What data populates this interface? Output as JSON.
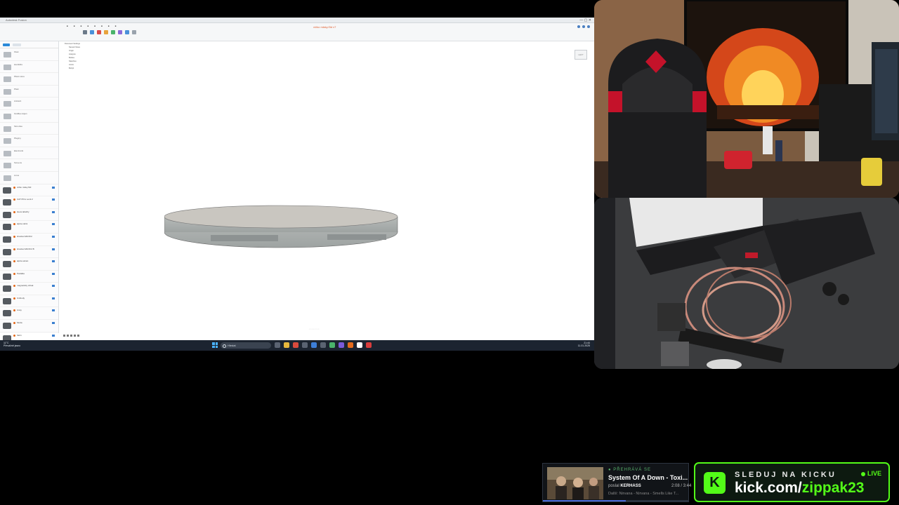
{
  "fusion": {
    "window_title": "Autodesk Fusion",
    "document_title": "víčko misky.f3d v7",
    "viewcube_label": "LEFT",
    "folders": [
      "Fitek",
      "Hardsfire",
      "Pliant store",
      "Pitek",
      "Antracit",
      "Grafika stojan",
      "Simonka",
      "Pluginy",
      "Electronik",
      "Screens",
      "Linos"
    ],
    "files": [
      {
        "name": "víčko misky.f3d"
      },
      {
        "name": "CAT PICs Lock 2"
      },
      {
        "name": "sleva tabelhy"
      },
      {
        "name": "alpina dolni"
      },
      {
        "name": "Hracka NAK3V2"
      },
      {
        "name": "Hracka NAK3V2 B"
      },
      {
        "name": "alpina ekran"
      },
      {
        "name": "Pedalka"
      },
      {
        "name": "magneticky drzak"
      },
      {
        "name": "Unibody"
      },
      {
        "name": "Lissy"
      },
      {
        "name": "Moda"
      },
      {
        "name": "Skrin"
      }
    ],
    "browser_tree": [
      "Document Settings",
      "Named Views",
      "Origin",
      "Analysis",
      "Bodies",
      "Sketches",
      "Joints",
      "Body1"
    ],
    "taskbar": {
      "weather_temp": "11°C",
      "weather_desc": "Převážně jasno",
      "search_placeholder": "Hledat",
      "time": "21:44",
      "date": "11.01.2025"
    }
  },
  "now_playing": {
    "label": "● PŘEHRÁVÁ SE",
    "song": "System Of A Down - Toxi...",
    "requested_by_prefix": "poslal",
    "requested_by": "KERHASS",
    "time": "2:08 / 3:44",
    "next": "Další: Nirvana - Nirvana - Smells Like T...",
    "progress": 0.57
  },
  "kick": {
    "logo_letter": "K",
    "cta": "SLEDUJ NA KICKU",
    "live": "LIVE",
    "url_prefix": "kick.com/",
    "url_user": "zippak23"
  },
  "colors": {
    "kick_green": "#53fc18",
    "fusion_accent": "#e46a1c",
    "taskbar": "#1c2430"
  }
}
